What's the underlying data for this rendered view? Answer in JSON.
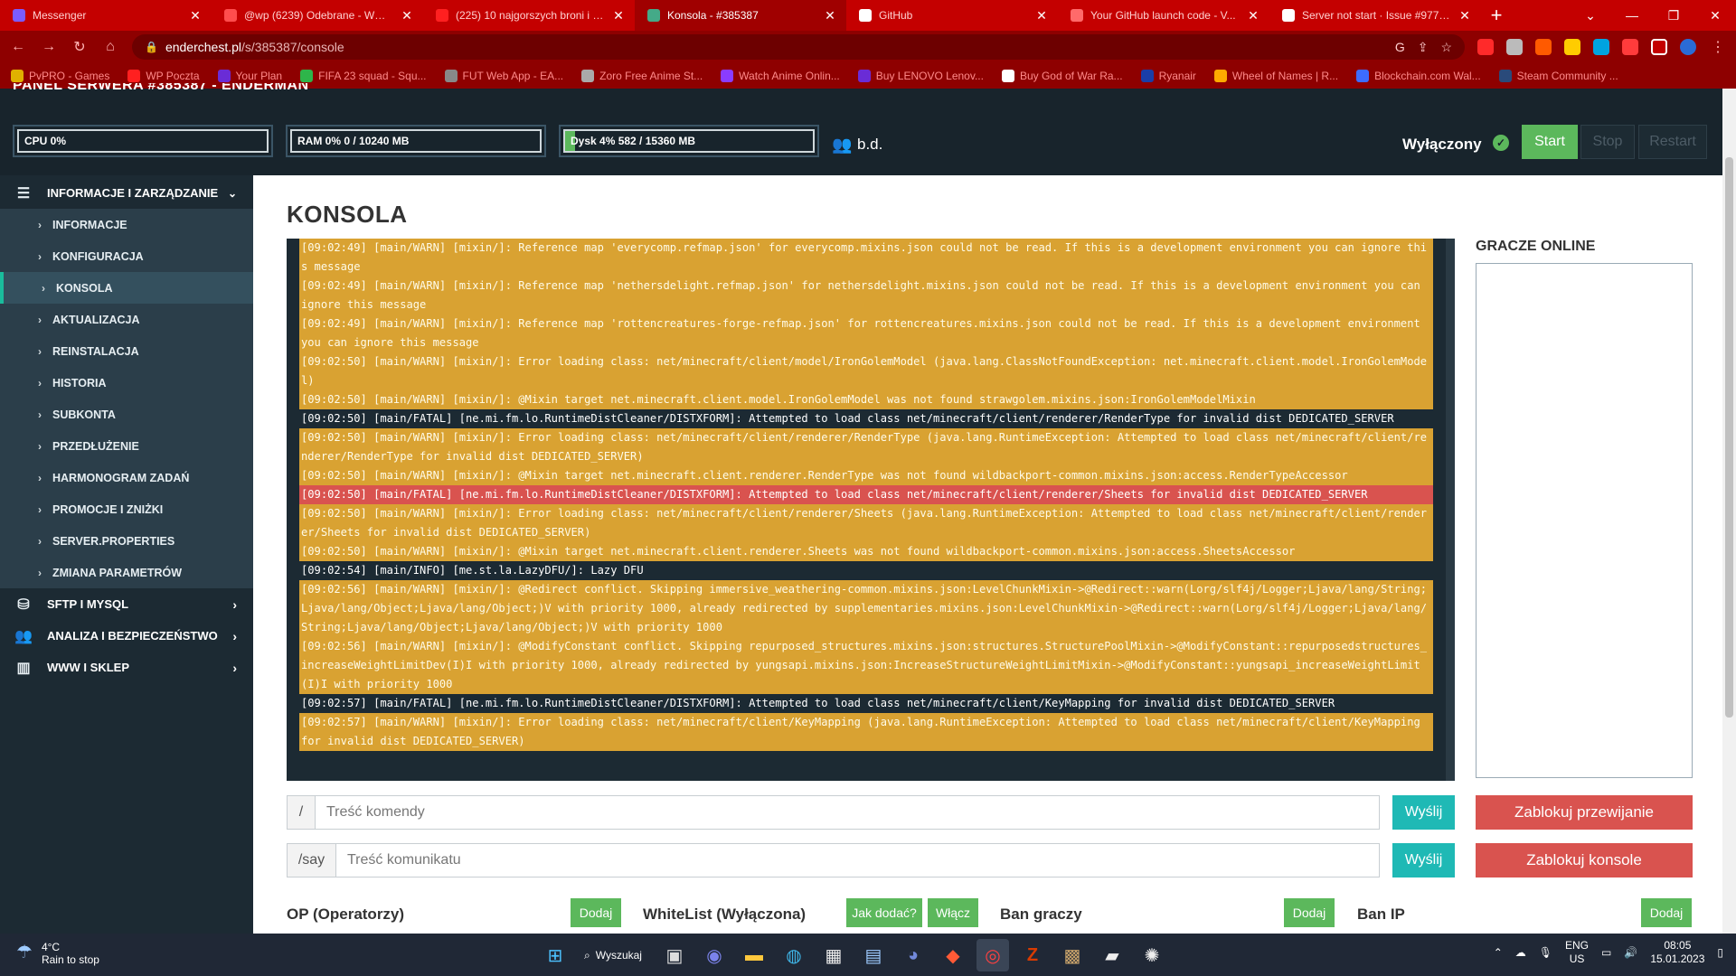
{
  "browser": {
    "tabs": [
      {
        "label": "Messenger",
        "color": "#7b5cff"
      },
      {
        "label": "@wp (6239) Odebrane - WP Po...",
        "color": "#ff4d4d"
      },
      {
        "label": "(225) 10 najgorszych broni i wo...",
        "color": "#ff2020"
      },
      {
        "label": "Konsola - #385387",
        "color": "#44aa88"
      },
      {
        "label": "GitHub",
        "color": "#ffffff"
      },
      {
        "label": "Your GitHub launch code - V...",
        "color": "#ff6a6a"
      },
      {
        "label": "Server not start · Issue #977 · L...",
        "color": "#ffffff"
      }
    ],
    "url_host": "enderchest.pl",
    "url_path": "/s/385387/console",
    "bookmarks": [
      {
        "label": "PvPRO - Games",
        "color": "#e0b000"
      },
      {
        "label": "WP Poczta",
        "color": "#ff2020"
      },
      {
        "label": "Your Plan",
        "color": "#6a2cd6"
      },
      {
        "label": "FIFA 23 squad - Squ...",
        "color": "#2eb54a"
      },
      {
        "label": "FUT Web App - EA...",
        "color": "#888888"
      },
      {
        "label": "Zoro Free Anime St...",
        "color": "#aaaaaa"
      },
      {
        "label": "Watch Anime Onlin...",
        "color": "#8a3cff"
      },
      {
        "label": "Buy LENOVO Lenov...",
        "color": "#6a2cd6"
      },
      {
        "label": "Buy God of War Ra...",
        "color": "#ffffff"
      },
      {
        "label": "Ryanair",
        "color": "#1a3ea8"
      },
      {
        "label": "Wheel of Names | R...",
        "color": "#ffaa00"
      },
      {
        "label": "Blockchain.com Wal...",
        "color": "#3d6cff"
      },
      {
        "label": "Steam Community ...",
        "color": "#2a4a7a"
      }
    ]
  },
  "panel": {
    "title_cut": "PANEL SERWERA #385387 - ENDERMAN",
    "cpu": {
      "label": "CPU 0%",
      "fraction": 0.0
    },
    "ram": {
      "label": "RAM 0% 0 / 10240 MB",
      "fraction": 0.0
    },
    "disk": {
      "label": "Dysk 4% 582 / 15360 MB",
      "fraction": 0.04
    },
    "players": "b.d.",
    "status": "Wyłączony",
    "buttons": {
      "start": "Start",
      "stop": "Stop",
      "restart": "Restart"
    }
  },
  "sidebar": {
    "items": [
      {
        "label": "INFORMACJE I ZARZĄDZANIE",
        "type": "section",
        "icon": "list-icon"
      },
      {
        "label": "INFORMACJE",
        "type": "sub"
      },
      {
        "label": "KONFIGURACJA",
        "type": "sub"
      },
      {
        "label": "KONSOLA",
        "type": "sub-active"
      },
      {
        "label": "AKTUALIZACJA",
        "type": "sub"
      },
      {
        "label": "REINSTALACJA",
        "type": "sub"
      },
      {
        "label": "HISTORIA",
        "type": "sub"
      },
      {
        "label": "SUBKONTA",
        "type": "sub"
      },
      {
        "label": "PRZEDŁUŻENIE",
        "type": "sub"
      },
      {
        "label": "HARMONOGRAM ZADAŃ",
        "type": "sub"
      },
      {
        "label": "PROMOCJE I ZNIŻKI",
        "type": "sub"
      },
      {
        "label": "SERVER.PROPERTIES",
        "type": "sub"
      },
      {
        "label": "ZMIANA PARAMETRÓW",
        "type": "sub"
      },
      {
        "label": "SFTP I MYSQL",
        "type": "section",
        "icon": "database-icon"
      },
      {
        "label": "ANALIZA I BEZPIECZEŃSTWO",
        "type": "section",
        "icon": "users-cog-icon"
      },
      {
        "label": "WWW I SKLEP",
        "type": "section",
        "icon": "window-icon"
      }
    ]
  },
  "main": {
    "title": "KONSOLA",
    "console_lines": [
      {
        "t": "[09:02:49] [main/WARN] [mixin/]: Reference map 'everycomp.refmap.json' for everycomp.mixins.json could not be read. If this is a development environment you can ignore this message",
        "k": "warn"
      },
      {
        "t": "[09:02:49] [main/WARN] [mixin/]: Reference map 'nethersdelight.refmap.json' for nethersdelight.mixins.json could not be read. If this is a development environment you can ignore this message",
        "k": "warn"
      },
      {
        "t": "[09:02:49] [main/WARN] [mixin/]: Reference map 'rottencreatures-forge-refmap.json' for rottencreatures.mixins.json could not be read. If this is a development environment you can ignore this message",
        "k": "warn"
      },
      {
        "t": "[09:02:50] [main/WARN] [mixin/]: Error loading class: net/minecraft/client/model/IronGolemModel (java.lang.ClassNotFoundException: net.minecraft.client.model.IronGolemModel)",
        "k": "warn"
      },
      {
        "t": "[09:02:50] [main/WARN] [mixin/]: @Mixin target net.minecraft.client.model.IronGolemModel was not found strawgolem.mixins.json:IronGolemModelMixin",
        "k": "warn"
      },
      {
        "t": "[09:02:50] [main/FATAL] [ne.mi.fm.lo.RuntimeDistCleaner/DISTXFORM]: Attempted to load class net/minecraft/client/renderer/RenderType for invalid dist DEDICATED_SERVER",
        "k": "fatal"
      },
      {
        "t": "[09:02:50] [main/WARN] [mixin/]: Error loading class: net/minecraft/client/renderer/RenderType (java.lang.RuntimeException: Attempted to load class net/minecraft/client/renderer/RenderType for invalid dist DEDICATED_SERVER)",
        "k": "warn"
      },
      {
        "t": "[09:02:50] [main/WARN] [mixin/]: @Mixin target net.minecraft.client.renderer.RenderType was not found wildbackport-common.mixins.json:access.RenderTypeAccessor",
        "k": "warn"
      },
      {
        "t": "[09:02:50] [main/FATAL] [ne.mi.fm.lo.RuntimeDistCleaner/DISTXFORM]: Attempted to load class net/minecraft/client/renderer/Sheets for invalid dist DEDICATED_SERVER",
        "k": "error"
      },
      {
        "t": "[09:02:50] [main/WARN] [mixin/]: Error loading class: net/minecraft/client/renderer/Sheets (java.lang.RuntimeException: Attempted to load class net/minecraft/client/renderer/Sheets for invalid dist DEDICATED_SERVER)",
        "k": "warn"
      },
      {
        "t": "[09:02:50] [main/WARN] [mixin/]: @Mixin target net.minecraft.client.renderer.Sheets was not found wildbackport-common.mixins.json:access.SheetsAccessor",
        "k": "warn"
      },
      {
        "t": "[09:02:54] [main/INFO] [me.st.la.LazyDFU/]: Lazy DFU",
        "k": "info"
      },
      {
        "t": "[09:02:56] [main/WARN] [mixin/]: @Redirect conflict. Skipping immersive_weathering-common.mixins.json:LevelChunkMixin->@Redirect::warn(Lorg/slf4j/Logger;Ljava/lang/String;Ljava/lang/Object;Ljava/lang/Object;)V with priority 1000, already redirected by supplementaries.mixins.json:LevelChunkMixin->@Redirect::warn(Lorg/slf4j/Logger;Ljava/lang/String;Ljava/lang/Object;Ljava/lang/Object;)V with priority 1000",
        "k": "warn"
      },
      {
        "t": "[09:02:56] [main/WARN] [mixin/]: @ModifyConstant conflict. Skipping repurposed_structures.mixins.json:structures.StructurePoolMixin->@ModifyConstant::repurposedstructures_increaseWeightLimitDev(I)I with priority 1000, already redirected by yungsapi.mixins.json:IncreaseStructureWeightLimitMixin->@ModifyConstant::yungsapi_increaseWeightLimit(I)I with priority 1000",
        "k": "warn"
      },
      {
        "t": "[09:02:57] [main/FATAL] [ne.mi.fm.lo.RuntimeDistCleaner/DISTXFORM]: Attempted to load class net/minecraft/client/KeyMapping for invalid dist DEDICATED_SERVER",
        "k": "fatal"
      },
      {
        "t": "[09:02:57] [main/WARN] [mixin/]: Error loading class: net/minecraft/client/KeyMapping (java.lang.RuntimeException: Attempted to load class net/minecraft/client/KeyMapping for invalid dist DEDICATED_SERVER)",
        "k": "warn"
      }
    ],
    "players_title": "GRACZE ONLINE",
    "command": {
      "prefix": "/",
      "placeholder": "Treść komendy",
      "send": "Wyślij"
    },
    "say": {
      "prefix": "/say",
      "placeholder": "Treść komunikatu",
      "send": "Wyślij"
    },
    "block_scroll": "Zablokuj przewijanie",
    "block_console": "Zablokuj konsole",
    "sections": {
      "op": "OP (Operatorzy)",
      "op_add": "Dodaj",
      "whitelist": "WhiteList (Wyłączona)",
      "whitelist_how": "Jak dodać?",
      "whitelist_enable": "Włącz",
      "ban_players": "Ban graczy",
      "ban_players_add": "Dodaj",
      "ban_ip": "Ban IP",
      "ban_ip_add": "Dodaj"
    }
  },
  "taskbar": {
    "weather_temp": "4°C",
    "weather_desc": "Rain to stop",
    "search": "Wyszukaj",
    "lang1": "ENG",
    "lang2": "US",
    "time": "08:05",
    "date": "15.01.2023"
  }
}
